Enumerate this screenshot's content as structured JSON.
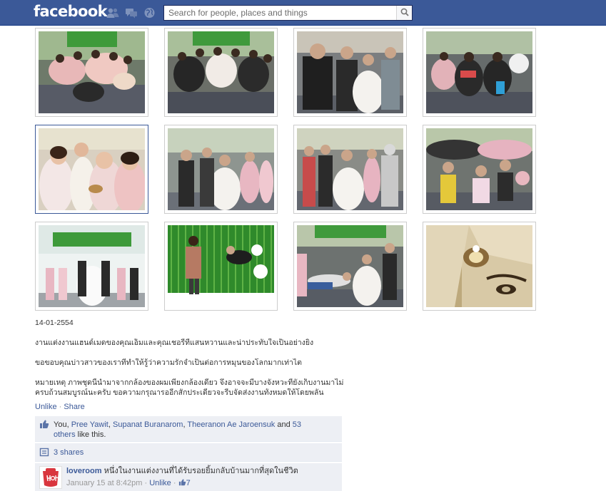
{
  "header": {
    "logo": "facebook",
    "search_placeholder": "Search for people, places and things",
    "icons": [
      "friends-icon",
      "messages-icon",
      "notifications-icon"
    ],
    "colors": {
      "bar": "#3b5998",
      "link": "#3b5998",
      "ufi_bg": "#edeff4"
    }
  },
  "photos": [
    {
      "name": "photo-1"
    },
    {
      "name": "photo-2"
    },
    {
      "name": "photo-3"
    },
    {
      "name": "photo-4"
    },
    {
      "name": "photo-5",
      "selected": true
    },
    {
      "name": "photo-6"
    },
    {
      "name": "photo-7"
    },
    {
      "name": "photo-8"
    },
    {
      "name": "photo-9"
    },
    {
      "name": "photo-10"
    },
    {
      "name": "photo-11"
    },
    {
      "name": "photo-12"
    }
  ],
  "caption": {
    "date": "14-01-2554",
    "line1": "งานแต่งงานแฮนด์เมดของคุณเอ็มและคุณเชอรี่ที่แสนหวานและน่าประทับใจเป็นอย่างยิ่ง",
    "line2": "ขอขอบคุณบ่าวสาวของเราที่ทำให้รู้ว่าความรักจำเป็นต่อการหมุนของโลกมากเท่าไต",
    "line3": "หมายเหตุ ภาพชุดนี้นำมาจากกล้องของผมเพียงกล้องเดียว จึงอาจจะมีบางจังหวะที่ยังเก็บงานมาไม่",
    "line4": "ครบถ้วนสมบูรณ์นะครับ ขอความกรุณารออีกสักประเดี๋ยวจะรีบจัดส่งงานทั้งหมดให้โดยพลัน"
  },
  "actions": {
    "unlike": "Unlike",
    "separator": "·",
    "share": "Share"
  },
  "likes": {
    "prefix": "You,",
    "names": [
      "Pree Yawit",
      "Supanat Buranarom",
      "Theeranon Ae Jaroensuk"
    ],
    "comma": ",",
    "and": "and",
    "others_count": "53",
    "others_label": "others",
    "suffix": "like this."
  },
  "shares": {
    "label": "3 shares"
  },
  "comment": {
    "author": "loveroom",
    "text": "หนึ่งในงานแต่งงานที่ได้รับรอยยิ้มกลับบ้านมากที่สุดในชีวิต",
    "timestamp": "January 15 at 8:42pm",
    "separator": "·",
    "unlike": "Unlike",
    "like_count": "7"
  }
}
